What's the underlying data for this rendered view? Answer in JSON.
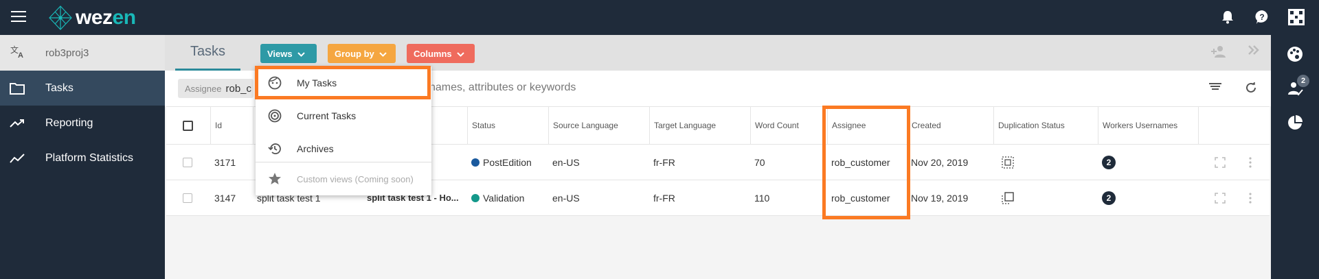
{
  "topbar": {
    "logo_text_1": "wez",
    "logo_text_2": "en"
  },
  "sidebar": {
    "project": "rob3proj3",
    "items": [
      {
        "label": "Tasks",
        "icon": "folder-icon"
      },
      {
        "label": "Reporting",
        "icon": "trending-icon"
      },
      {
        "label": "Platform Statistics",
        "icon": "line-chart-icon"
      }
    ]
  },
  "header": {
    "title": "Tasks",
    "views_label": "Views",
    "groupby_label": "Group by",
    "columns_label": "Columns"
  },
  "filter": {
    "chip_label": "Assignee",
    "chip_value": "rob_c",
    "placeholder_tail": "names, attributes or keywords"
  },
  "table": {
    "columns": [
      "Id",
      "Status",
      "Source Language",
      "Target Language",
      "Word Count",
      "Assignee",
      "Created",
      "Duplication Status",
      "Workers Usernames"
    ],
    "rows": [
      {
        "id": "3171",
        "name": "",
        "title": "",
        "status": "PostEdition",
        "status_color": "#1a5a9e",
        "source": "en-US",
        "target": "fr-FR",
        "words": "70",
        "assignee": "rob_customer",
        "created": "Nov 20, 2019",
        "workers": "2"
      },
      {
        "id": "3147",
        "name": "split task test 1",
        "title": "split task test 1 - Ho...",
        "status": "Validation",
        "status_color": "#13988a",
        "source": "en-US",
        "target": "fr-FR",
        "words": "110",
        "assignee": "rob_customer",
        "created": "Nov 19, 2019",
        "workers": "2"
      }
    ]
  },
  "views_menu": {
    "items": [
      {
        "label": "My Tasks",
        "icon": "face-icon"
      },
      {
        "label": "Current Tasks",
        "icon": "target-icon"
      },
      {
        "label": "Archives",
        "icon": "history-icon"
      },
      {
        "label": "Custom views (Coming soon)",
        "icon": "star-icon",
        "disabled": true
      }
    ]
  },
  "rightrail": {
    "badge": "2"
  },
  "colors": {
    "topbar": "#1f2b3a",
    "views": "#2e9aa6",
    "groupby": "#f5a640",
    "columns": "#ef6b5d",
    "highlight": "#fb7a23"
  }
}
